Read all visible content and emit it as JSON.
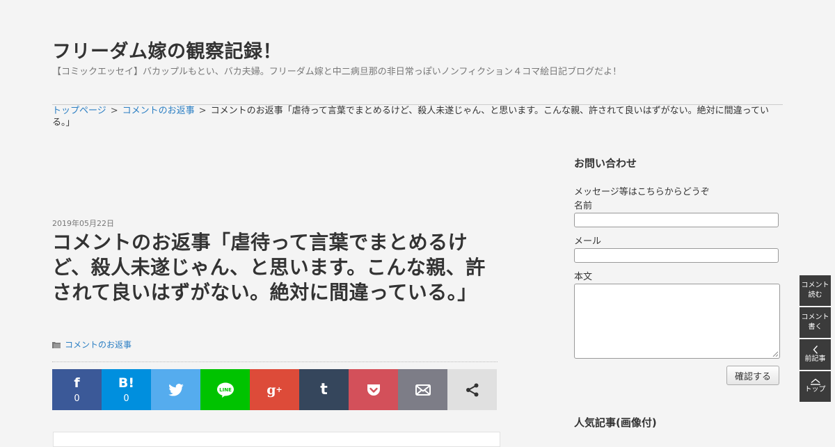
{
  "site": {
    "title": "フリーダム嫁の観察記録！",
    "description": "【コミックエッセイ】バカップルもとい、バカ夫婦。フリーダム嫁と中二病旦那の非日常っぽいノンフィクション４コマ絵日記ブログだよ！"
  },
  "breadcrumb": {
    "items": [
      "トップページ",
      "コメントのお返事"
    ],
    "separator": ">",
    "current": "コメントのお返事「虐待って言葉でまとめるけど、殺人未遂じゃん、と思います。こんな親、許されて良いはずがない。絶対に間違っている。」"
  },
  "post": {
    "date": "2019年05月22日",
    "title": "コメントのお返事「虐待って言葉でまとめるけど、殺人未遂じゃん、と思います。こんな親、許されて良いはずがない。絶対に間違っている。」",
    "category": "コメントのお返事"
  },
  "share": {
    "facebook": {
      "icon": "f",
      "count": "0",
      "color": "#3b5998"
    },
    "hatena": {
      "icon": "B!",
      "count": "0",
      "color": "#008fde"
    },
    "twitter": {
      "icon": "twitter-bird",
      "color": "#55acee"
    },
    "line": {
      "icon": "LINE",
      "color": "#00c300"
    },
    "googleplus": {
      "icon": "g+",
      "color": "#dd4b39"
    },
    "tumblr": {
      "icon": "t",
      "color": "#35465c"
    },
    "pocket": {
      "icon": "pocket",
      "color": "#d3505a"
    },
    "mail": {
      "icon": "mail",
      "color": "#7d7d87"
    },
    "more": {
      "icon": "share",
      "color": "#e0e0e0"
    }
  },
  "sidebar": {
    "contact": {
      "title": "お問い合わせ",
      "intro": "メッセージ等はこちらからどうぞ",
      "name_label": "名前",
      "mail_label": "メール",
      "body_label": "本文",
      "submit": "確認する"
    },
    "popular_title": "人気記事(画像付)"
  },
  "side_nav": {
    "read_comments": [
      "コメント",
      "読む"
    ],
    "write_comment": [
      "コメント",
      "書く"
    ],
    "prev": "前記事",
    "top": "トップ"
  }
}
